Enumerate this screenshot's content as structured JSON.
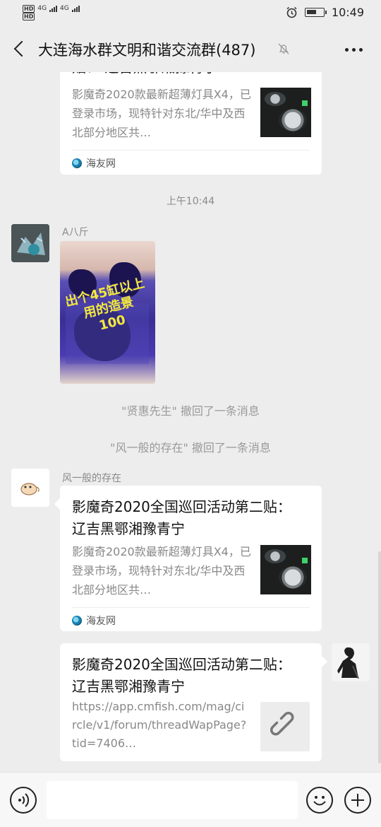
{
  "status_bar": {
    "hd1": "HD",
    "hd2": "HD",
    "net1": "4G",
    "net2": "4G",
    "time": "10:49",
    "battery_level": 0.6,
    "icons": [
      "hd-icon",
      "signal-icon",
      "alarm-icon",
      "battery-icon"
    ]
  },
  "header": {
    "title": "大连海水群文明和谐交流群(487)",
    "icons": [
      "back-icon",
      "mute-bell-icon",
      "more-icon"
    ]
  },
  "messages": {
    "top_card": {
      "title_partial": "贴：  辽吉黑鄂湘豫青宁",
      "desc": "影魔奇2020款最新超薄灯具X4，已登录市场，现特针对东北/华中及西北部分地区共…",
      "source": "海友网"
    },
    "time_label": "上午10:44",
    "photo_msg": {
      "sender": "A八斤",
      "overlay_text": "出个45缸以上\n用的造景\n100"
    },
    "recall_1": "\"贤惠先生\" 撤回了一条消息",
    "recall_2": "\"风一般的存在\" 撤回了一条消息",
    "link_msg": {
      "sender": "风一般的存在",
      "title": "影魔奇2020全国巡回活动第二贴：  辽吉黑鄂湘豫青宁",
      "desc": "影魔奇2020款最新超薄灯具X4，已登录市场，现特针对东北/华中及西北部分地区共…",
      "source": "海友网"
    },
    "own_msg": {
      "title": "影魔奇2020全国巡回活动第二贴：  辽吉黑鄂湘豫青宁",
      "url": "https://app.cmfish.com/mag/circle/v1/forum/threadWapPage?tid=7406…"
    }
  },
  "input_bar": {
    "value": "",
    "icons": [
      "voice-icon",
      "emoji-icon",
      "plus-icon"
    ]
  }
}
